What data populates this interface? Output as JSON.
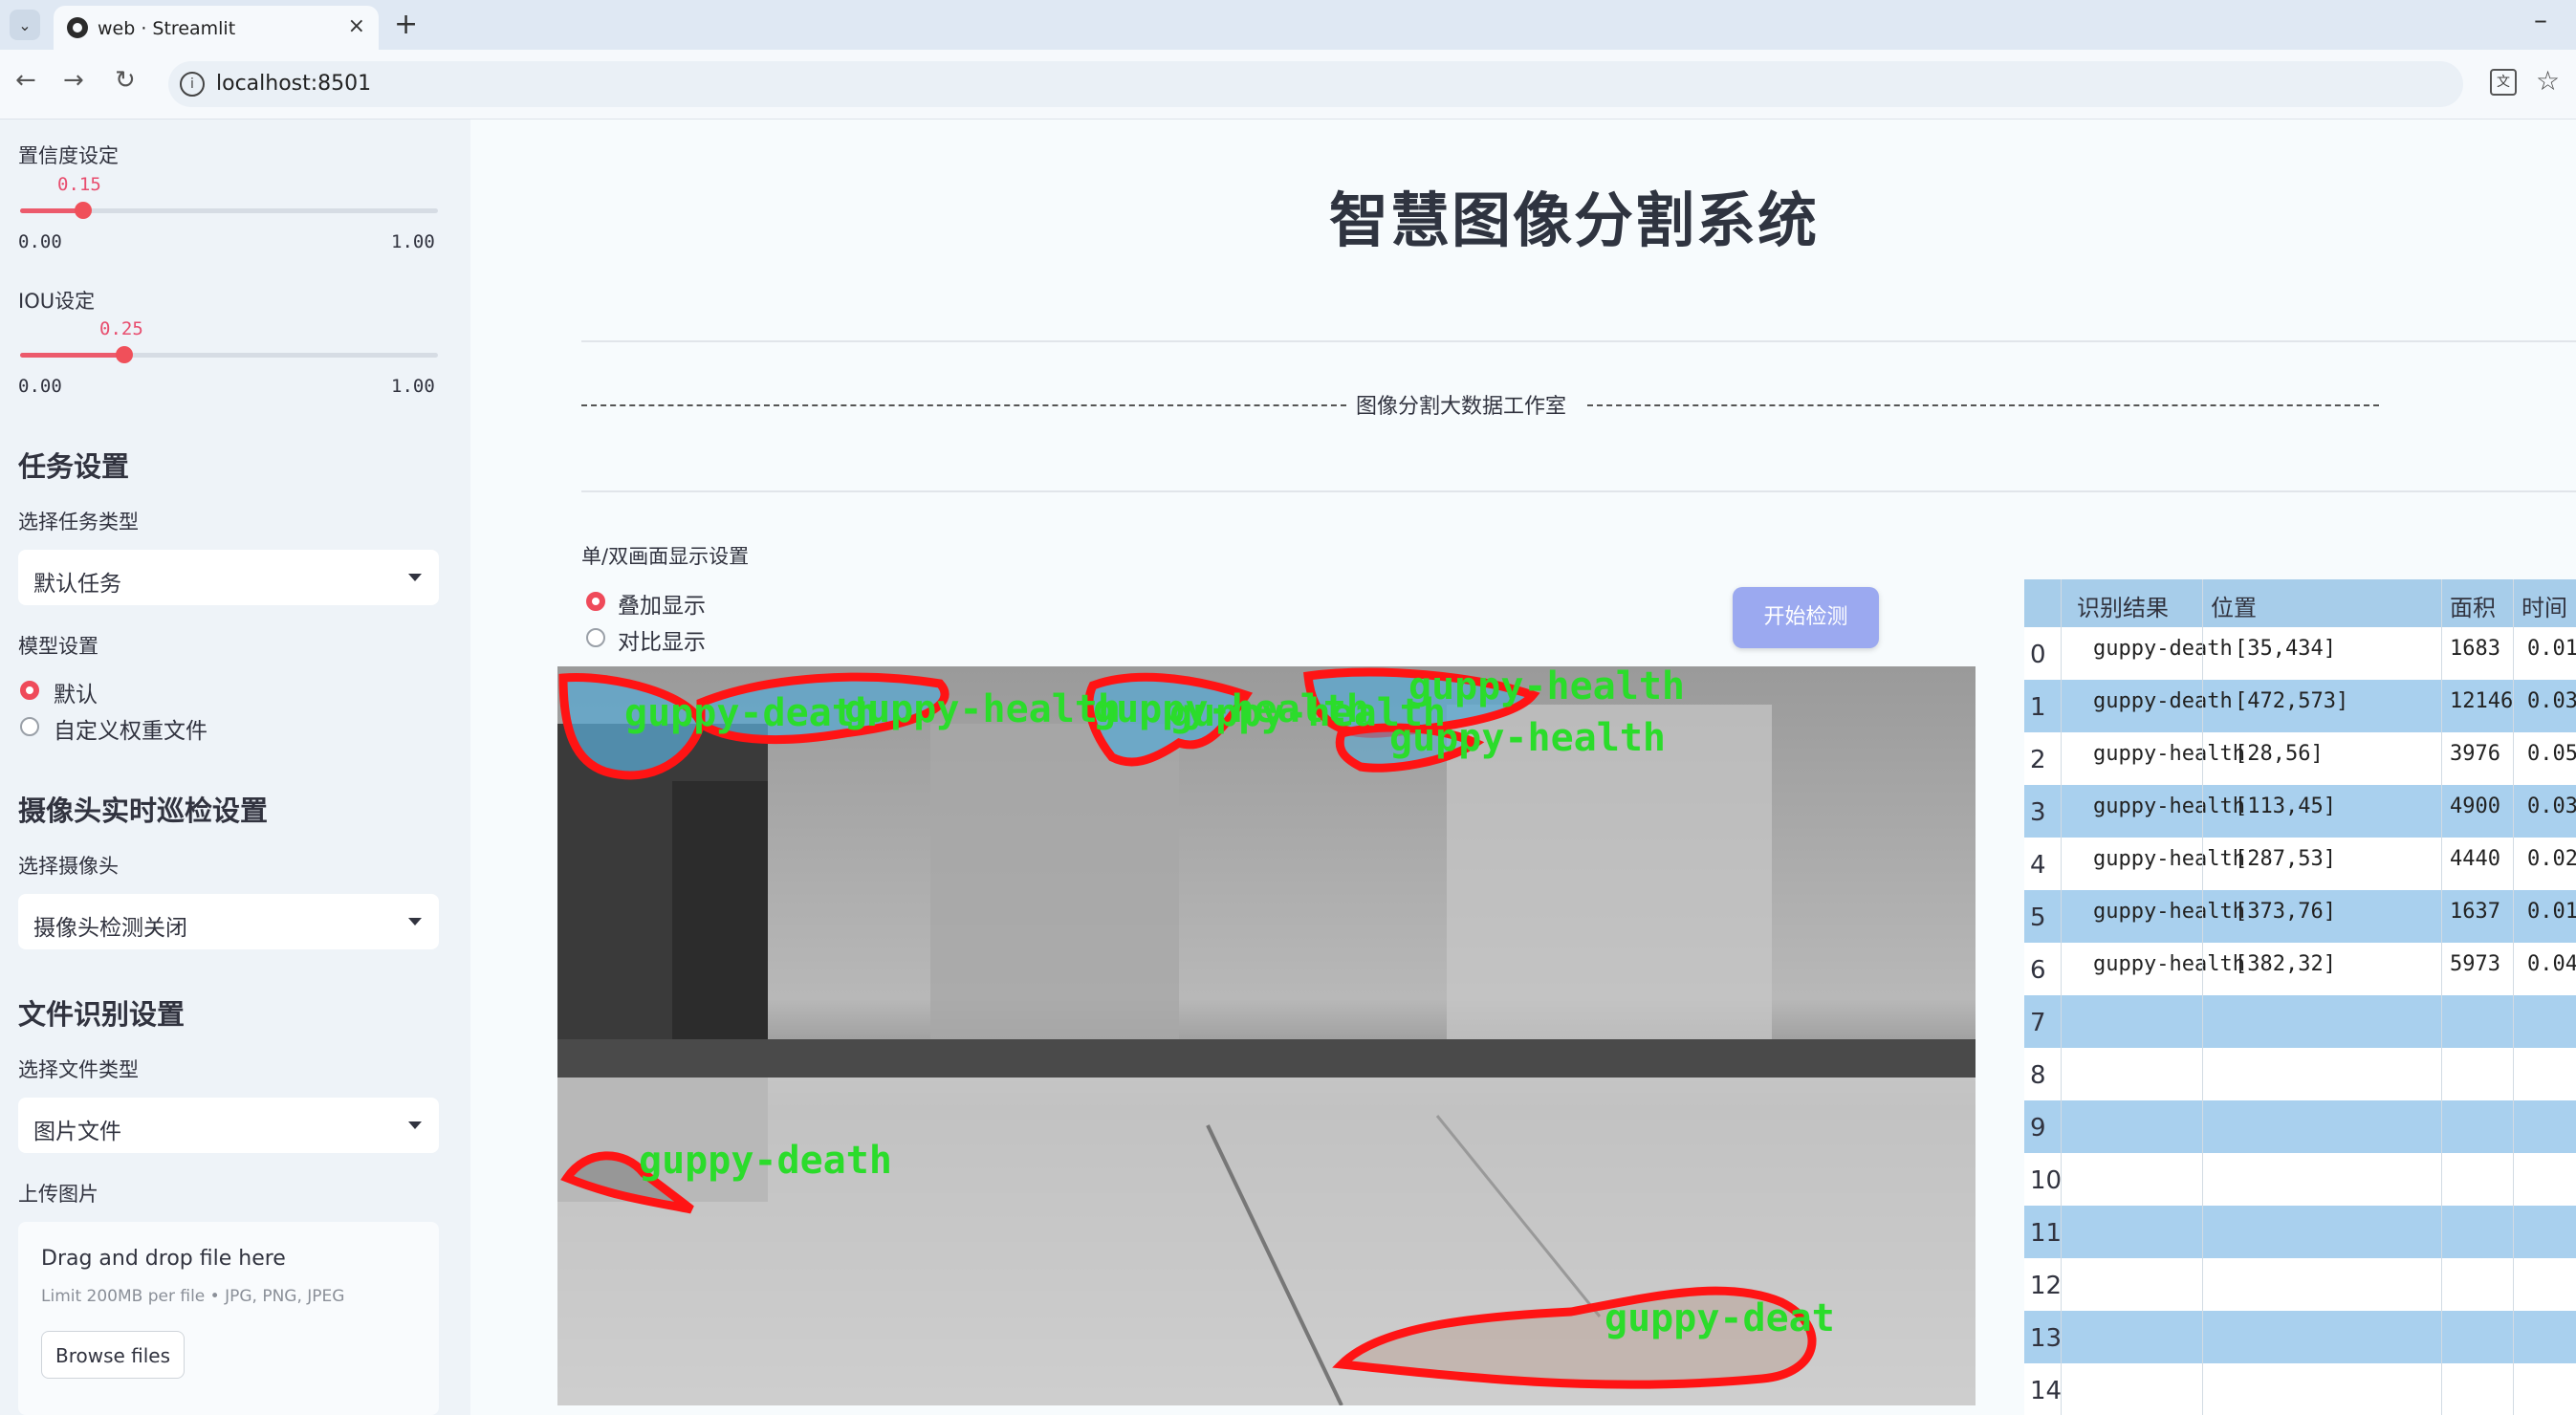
{
  "browser": {
    "tab_title": "web · Streamlit",
    "url": "localhost:8501"
  },
  "sidebar": {
    "confidence": {
      "label": "置信度设定",
      "value": "0.15",
      "min": "0.00",
      "max": "1.00",
      "fraction": 0.15
    },
    "iou": {
      "label": "IOU设定",
      "value": "0.25",
      "min": "0.00",
      "max": "1.00",
      "fraction": 0.25
    },
    "task_section": "任务设置",
    "task_type_label": "选择任务类型",
    "task_type_value": "默认任务",
    "model_label": "模型设置",
    "model_options": [
      "默认",
      "自定义权重文件"
    ],
    "model_selected": 0,
    "camera_section": "摄像头实时巡检设置",
    "camera_label": "选择摄像头",
    "camera_value": "摄像头检测关闭",
    "file_section": "文件识别设置",
    "file_type_label": "选择文件类型",
    "file_type_value": "图片文件",
    "upload_label": "上传图片",
    "upload_title": "Drag and drop file here",
    "upload_limit": "Limit 200MB per file • JPG, PNG, JPEG",
    "browse_button": "Browse files"
  },
  "main": {
    "title": "智慧图像分割系统",
    "banner": "图像分割大数据工作室",
    "display_label": "单/双画面显示设置",
    "display_options": [
      "叠加显示",
      "对比显示"
    ],
    "display_selected": 0,
    "detect_button": "开始检测",
    "overlay_labels": [
      "guppy-health",
      "guppy-death",
      "guppy-health",
      "guppy-health",
      "guppy-health",
      "guppy-health",
      "guppy-death",
      "guppy-deat"
    ]
  },
  "table": {
    "columns": [
      "识别结果",
      "位置",
      "面积",
      "时间"
    ],
    "rows": [
      {
        "idx": "0",
        "result": "guppy-death",
        "pos": "[35,434]",
        "area": "1683",
        "time": "0.01"
      },
      {
        "idx": "1",
        "result": "guppy-death",
        "pos": "[472,573]",
        "area": "12146",
        "time": "0.03"
      },
      {
        "idx": "2",
        "result": "guppy-health",
        "pos": "[28,56]",
        "area": "3976",
        "time": "0.05"
      },
      {
        "idx": "3",
        "result": "guppy-health",
        "pos": "[113,45]",
        "area": "4900",
        "time": "0.03"
      },
      {
        "idx": "4",
        "result": "guppy-health",
        "pos": "[287,53]",
        "area": "4440",
        "time": "0.02"
      },
      {
        "idx": "5",
        "result": "guppy-health",
        "pos": "[373,76]",
        "area": "1637",
        "time": "0.01"
      },
      {
        "idx": "6",
        "result": "guppy-health",
        "pos": "[382,32]",
        "area": "5973",
        "time": "0.04"
      },
      {
        "idx": "7"
      },
      {
        "idx": "8"
      },
      {
        "idx": "9"
      },
      {
        "idx": "10"
      },
      {
        "idx": "11"
      },
      {
        "idx": "12"
      },
      {
        "idx": "13"
      },
      {
        "idx": "14"
      }
    ]
  },
  "colors": {
    "accent": "#ef4a5a",
    "button": "#9ba9f0",
    "table_header": "#a7cdea",
    "mask": "#5aa8d2",
    "outline": "#ff1414",
    "label": "#2bdc2b"
  }
}
